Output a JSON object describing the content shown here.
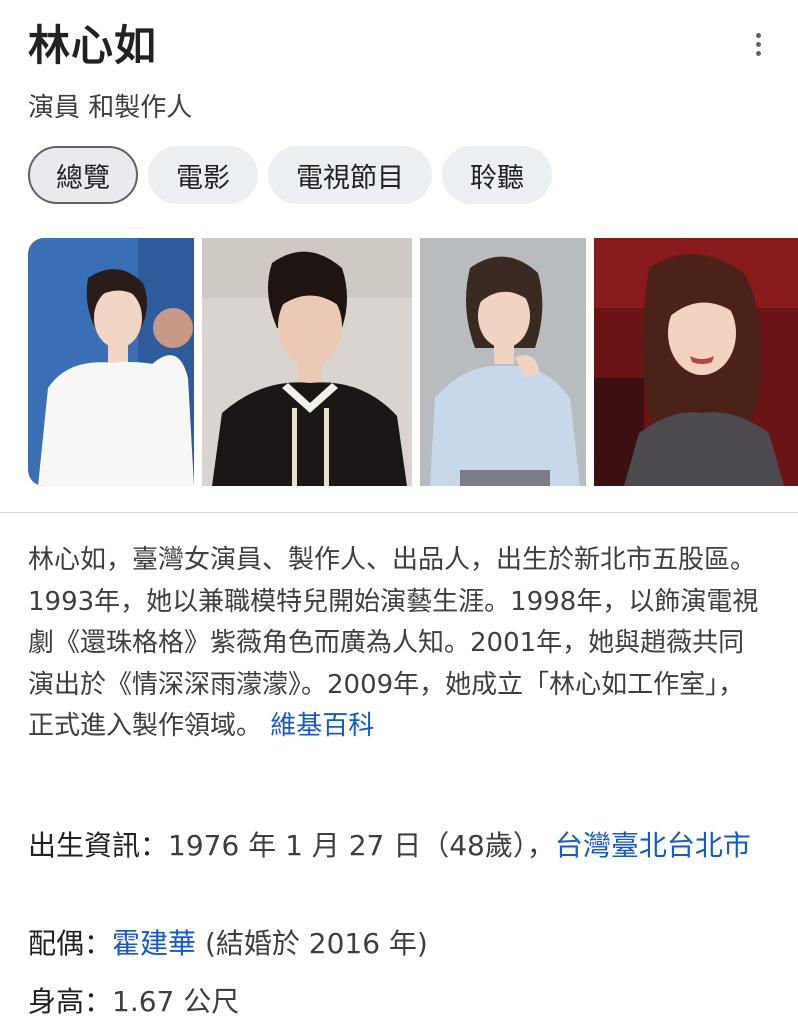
{
  "header": {
    "title": "林心如",
    "subtitle": "演員 和製作人",
    "more_icon": "more-vert-icon"
  },
  "tabs": [
    {
      "label": "總覽",
      "selected": true
    },
    {
      "label": "電影",
      "selected": false
    },
    {
      "label": "電視節目",
      "selected": false
    },
    {
      "label": "聆聽",
      "selected": false
    }
  ],
  "description": {
    "text": "林心如，臺灣女演員、製作人、出品人，出生於新北市五股區。 1993年，她以兼職模特兒開始演藝生涯。1998年，以飾演電視劇《還珠格格》紫薇角色而廣為人知。2001年，她與趙薇共同演出於《情深深雨濛濛》。2009年，她成立「林心如工作室」，正式進入製作領域。",
    "source_link": "維基百科"
  },
  "facts": {
    "birth": {
      "label": "出生資訊：",
      "value": "1976 年 1 月 27 日（48歲），",
      "link": "台灣臺北台北市"
    },
    "spouse": {
      "label": "配偶：",
      "link": "霍建華",
      "value": "(結婚於 2016 年)"
    },
    "height": {
      "label": "身高：",
      "value": "1.67 公尺"
    }
  },
  "colors": {
    "link": "#1558d6",
    "chip_bg": "#eceff1",
    "text": "#3c4043"
  }
}
